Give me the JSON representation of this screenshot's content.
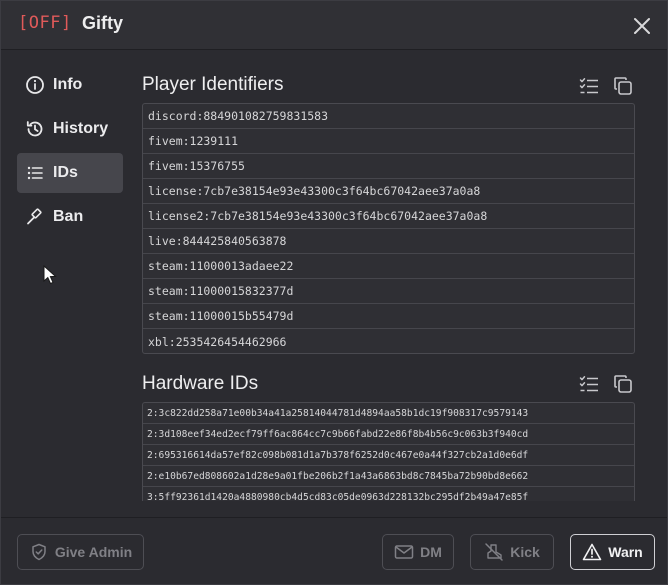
{
  "header": {
    "status": "[OFF]",
    "player_name": "Gifty"
  },
  "sidebar": {
    "items": [
      {
        "label": "Info",
        "icon": "info-icon",
        "active": false
      },
      {
        "label": "History",
        "icon": "history-icon",
        "active": false
      },
      {
        "label": "IDs",
        "icon": "list-icon",
        "active": true
      },
      {
        "label": "Ban",
        "icon": "gavel-icon",
        "active": false
      }
    ]
  },
  "player_ids": {
    "title": "Player Identifiers",
    "rows": [
      "discord:884901082759831583",
      "fivem:1239111",
      "fivem:15376755",
      "license:7cb7e38154e93e43300c3f64bc67042aee37a0a8",
      "license2:7cb7e38154e93e43300c3f64bc67042aee37a0a8",
      "live:844425840563878",
      "steam:11000013adaee22",
      "steam:11000015832377d",
      "steam:11000015b55479d",
      "xbl:2535426454462966"
    ]
  },
  "hardware_ids": {
    "title": "Hardware IDs",
    "rows": [
      "2:3c822dd258a71e00b34a41a25814044781d4894aa58b1dc19f908317c9579143",
      "2:3d108eef34ed2ecf79ff6ac864cc7c9b66fabd22e86f8b4b56c9c063b3f940cd",
      "2:695316614da57ef82c098b081d1a7b378f6252d0c467e0a44f327cb2a1d0e6df",
      "2:e10b67ed808602a1d28e9a01fbe206b2f1a43a6863bd8c7845ba72b90bd8e662",
      "3:5ff92361d1420a4880980cb4d5cd83c05de0963d228132bc295df2b49a47e85f"
    ]
  },
  "footer": {
    "give_admin": "Give Admin",
    "dm": "DM",
    "kick": "Kick",
    "warn": "Warn"
  }
}
